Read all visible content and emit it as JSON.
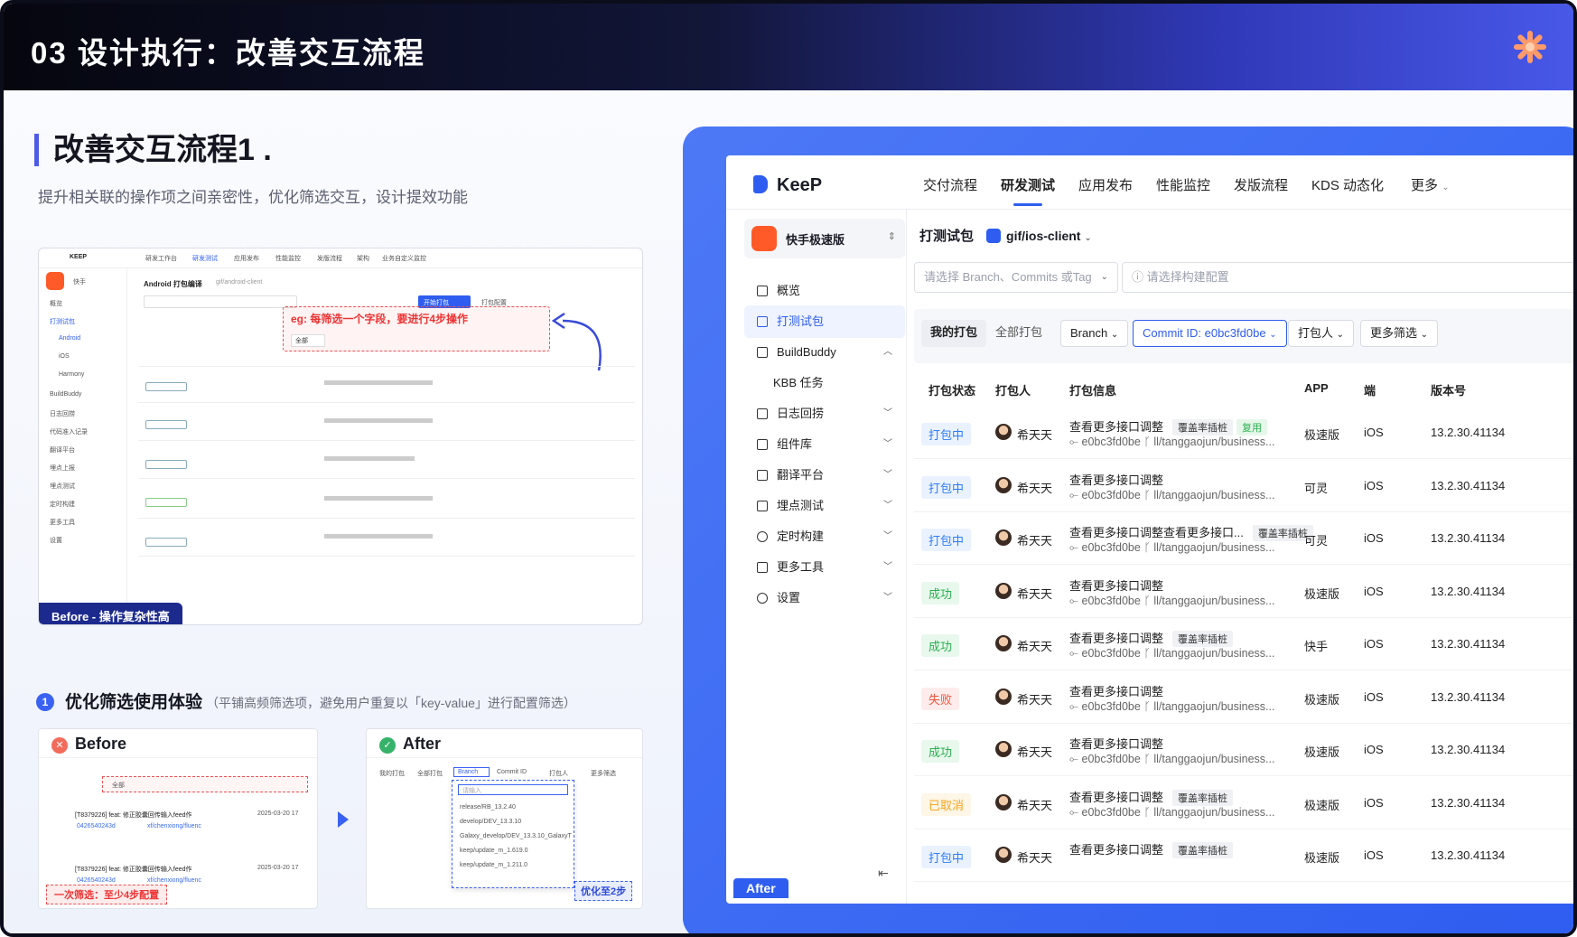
{
  "page": {
    "title": "03 设计执行：改善交互流程",
    "section_title": "改善交互流程1 .",
    "section_subtitle": "提升相关联的操作项之间亲密性，优化筛选交互，设计提效功能"
  },
  "before_shot": {
    "badge": "Before - 操作复杂性高",
    "annotation": "eg: 每筛选一个字段，要进行4步操作",
    "nav": [
      "KEEP",
      "研发工作台",
      "研发测试",
      "应用发布",
      "性能监控",
      "发版流程",
      "架构",
      "业务自定义监控"
    ],
    "page_title": "Android 打包编译",
    "repo": "gif/android-client",
    "start_button": "开始打包",
    "config_button": "打包配置",
    "filter_all": "全部",
    "side_items": [
      "快手",
      "概览",
      "打测试包",
      "Android",
      "iOS",
      "Harmony",
      "BuildBuddy",
      "日志回捞",
      "代码准入记录",
      "翻译平台",
      "埋点上报",
      "埋点测试",
      "定时构建",
      "更多工具",
      "设置"
    ]
  },
  "optimize": {
    "index": "1",
    "title": "优化筛选使用体验",
    "note": "（平铺高频筛选项，避免用户重复以「key-value」进行配置筛选）",
    "before_label": "Before",
    "after_label": "After",
    "before_tag": "一次筛选：至少4步配置",
    "after_tag": "优化至2步",
    "before_filter_all": "全部",
    "before_row1": "[T8379226] feat: 修正胶囊回传输入feed作",
    "before_row2": "[T8379226] feat: 修正胶囊回传输入feed作",
    "before_hash": "0426540243d",
    "before_branch": "xf/chenxiong/fluenc",
    "before_date": "2025-03-20 17",
    "after_chips": [
      "我的打包",
      "全部打包",
      "Branch",
      "Commit ID",
      "打包人",
      "更多筛选"
    ],
    "after_options": [
      "release/RB_13.2.40",
      "develop/DEV_13.3.10",
      "Galaxy_develop/DEV_13.3.10_GalaxyT",
      "keep/update_m_1.619.0",
      "keep/update_m_1.211.0"
    ],
    "after_search_placeholder": "请输入"
  },
  "app": {
    "logo": "KeeP",
    "nav": [
      "交付流程",
      "研发测试",
      "应用发布",
      "性能监控",
      "发版流程",
      "KDS 动态化",
      "更多"
    ],
    "nav_active": 1,
    "app_name": "快手极速版",
    "sidebar": [
      {
        "label": "概览",
        "chevron": ""
      },
      {
        "label": "打测试包",
        "chevron": ""
      },
      {
        "label": "BuildBuddy",
        "chevron": "^"
      },
      {
        "label": "KBB 任务",
        "chevron": ""
      },
      {
        "label": "日志回捞",
        "chevron": "v"
      },
      {
        "label": "组件库",
        "chevron": "v"
      },
      {
        "label": "翻译平台",
        "chevron": "v"
      },
      {
        "label": "埋点测试",
        "chevron": "v"
      },
      {
        "label": "定时构建",
        "chevron": "v"
      },
      {
        "label": "更多工具",
        "chevron": "v"
      },
      {
        "label": "设置",
        "chevron": "v"
      }
    ],
    "page_title": "打测试包",
    "repo": "gif/ios-client",
    "branch_placeholder": "请选择 Branch、Commits 或Tag",
    "config_placeholder": "请选择构建配置",
    "filters": [
      "我的打包",
      "全部打包",
      "Branch",
      "Commit ID:  e0bc3fd0be",
      "打包人",
      "更多筛选"
    ],
    "columns": [
      "打包状态",
      "打包人",
      "打包信息",
      "APP",
      "端",
      "版本号"
    ],
    "rows": [
      {
        "status": "打包中",
        "who": "希天天",
        "title": "查看更多接口调整",
        "tag": "覆盖率插桩",
        "tag2": "复用",
        "hash": "e0bc3fd0be",
        "branch": "ll/tanggaojun/business...",
        "app": "极速版",
        "end": "iOS",
        "ver": "13.2.30.41134"
      },
      {
        "status": "打包中",
        "who": "希天天",
        "title": "查看更多接口调整",
        "tag": "",
        "tag2": "",
        "hash": "e0bc3fd0be",
        "branch": "ll/tanggaojun/business...",
        "app": "可灵",
        "end": "iOS",
        "ver": "13.2.30.41134"
      },
      {
        "status": "打包中",
        "who": "希天天",
        "title": "查看更多接口调整查看更多接口...",
        "tag": "覆盖率插桩",
        "tag2": "",
        "hash": "e0bc3fd0be",
        "branch": "ll/tanggaojun/business...",
        "app": "可灵",
        "end": "iOS",
        "ver": "13.2.30.41134"
      },
      {
        "status": "成功",
        "who": "希天天",
        "title": "查看更多接口调整",
        "tag": "",
        "tag2": "",
        "hash": "e0bc3fd0be",
        "branch": "ll/tanggaojun/business...",
        "app": "极速版",
        "end": "iOS",
        "ver": "13.2.30.41134"
      },
      {
        "status": "成功",
        "who": "希天天",
        "title": "查看更多接口调整",
        "tag": "覆盖率插桩",
        "tag2": "",
        "hash": "e0bc3fd0be",
        "branch": "ll/tanggaojun/business...",
        "app": "快手",
        "end": "iOS",
        "ver": "13.2.30.41134"
      },
      {
        "status": "失败",
        "who": "希天天",
        "title": "查看更多接口调整",
        "tag": "",
        "tag2": "",
        "hash": "e0bc3fd0be",
        "branch": "ll/tanggaojun/business...",
        "app": "极速版",
        "end": "iOS",
        "ver": "13.2.30.41134"
      },
      {
        "status": "成功",
        "who": "希天天",
        "title": "查看更多接口调整",
        "tag": "",
        "tag2": "",
        "hash": "e0bc3fd0be",
        "branch": "ll/tanggaojun/business...",
        "app": "极速版",
        "end": "iOS",
        "ver": "13.2.30.41134"
      },
      {
        "status": "已取消",
        "who": "希天天",
        "title": "查看更多接口调整",
        "tag": "覆盖率插桩",
        "tag2": "",
        "hash": "e0bc3fd0be",
        "branch": "ll/tanggaojun/business...",
        "app": "极速版",
        "end": "iOS",
        "ver": "13.2.30.41134"
      },
      {
        "status": "打包中",
        "who": "希天天",
        "title": "查看更多接口调整",
        "tag": "覆盖率插桩",
        "tag2": "",
        "hash": "",
        "branch": "",
        "app": "极速版",
        "end": "iOS",
        "ver": "13.2.30.41134"
      }
    ],
    "after_badge": "After"
  },
  "colors": {
    "accent": "#2e5df0",
    "status_running": "#2e7cf6",
    "status_success": "#2ab04f",
    "status_fail": "#f2553d",
    "status_cancel": "#f5a623"
  }
}
